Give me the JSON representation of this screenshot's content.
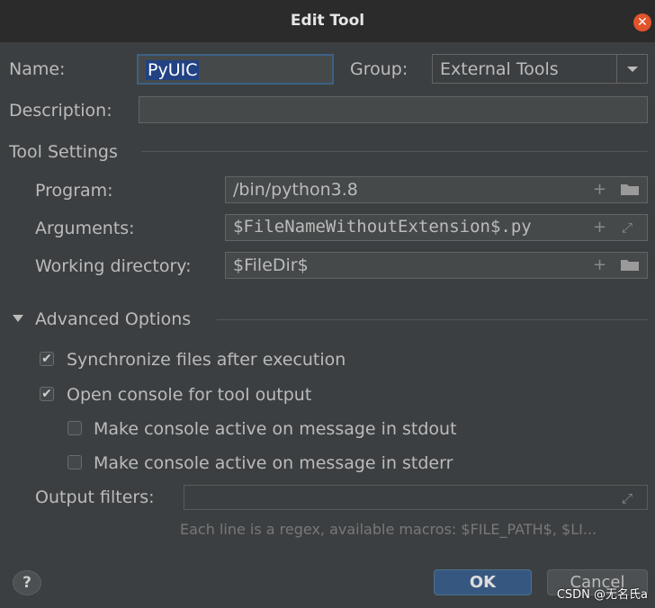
{
  "window": {
    "title": "Edit Tool"
  },
  "name": {
    "label": "Name:",
    "value": "PyUIC"
  },
  "group": {
    "label": "Group:",
    "value": "External Tools"
  },
  "description": {
    "label": "Description:",
    "value": ""
  },
  "tool_settings": {
    "title": "Tool Settings",
    "program": {
      "label": "Program:",
      "value": "/bin/python3.8"
    },
    "arguments": {
      "label": "Arguments:",
      "value": "$FileNameWithoutExtension$.py"
    },
    "working_directory": {
      "label": "Working directory:",
      "value": "$FileDir$"
    }
  },
  "advanced": {
    "title": "Advanced Options",
    "options": [
      {
        "label": "Synchronize files after execution",
        "checked": true
      },
      {
        "label": "Open console for tool output",
        "checked": true
      },
      {
        "label": "Make console active on message in stdout",
        "checked": false
      },
      {
        "label": "Make console active on message in stderr",
        "checked": false
      }
    ],
    "output_filters": {
      "label": "Output filters:",
      "value": ""
    },
    "hint": "Each line is a regex, available macros: $FILE_PATH$, $LI..."
  },
  "buttons": {
    "help": "?",
    "ok": "OK",
    "cancel": "Cancel"
  },
  "watermark": "CSDN @无名氏a",
  "colors": {
    "accent": "#365880",
    "selection": "#214283",
    "close": "#e0542c"
  }
}
